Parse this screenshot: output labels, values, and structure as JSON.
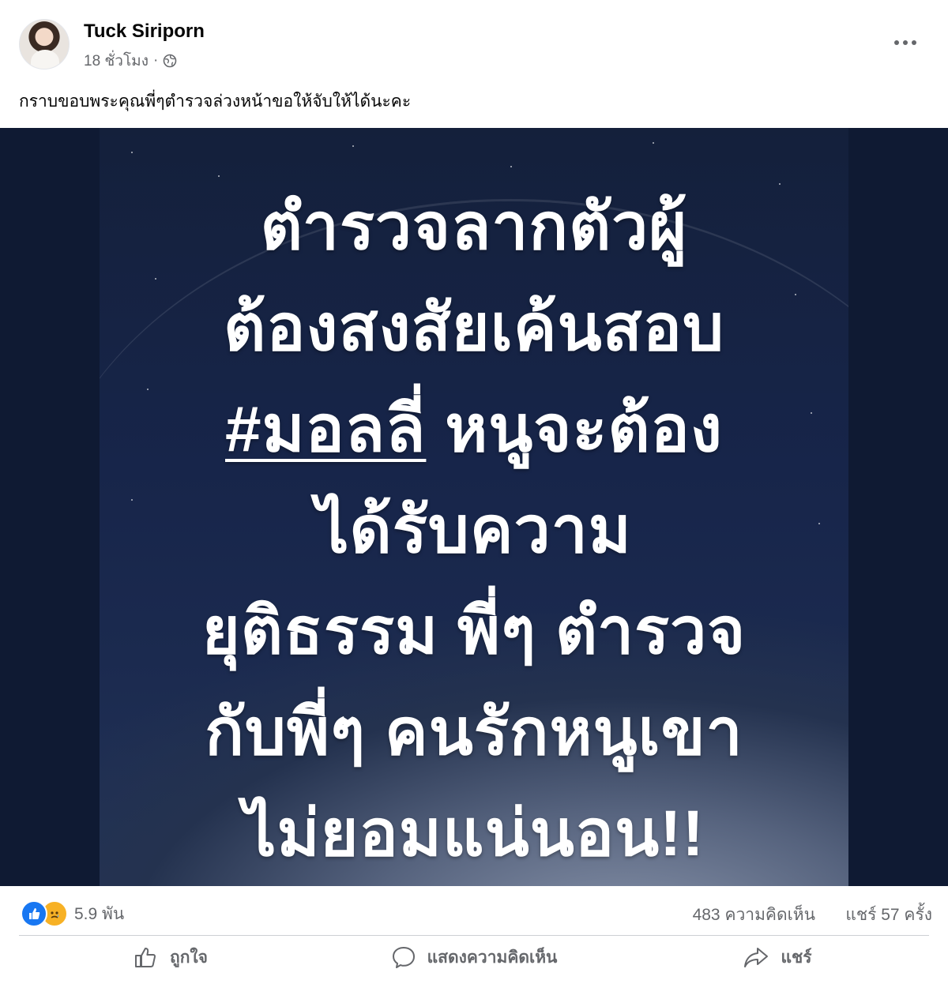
{
  "post": {
    "author": "Tuck Siriporn",
    "time": "18 ชั่วโมง",
    "separator": "·",
    "privacy_icon": "globe-icon",
    "caption": "กราบขอบพระคุณพี่ๆตำรวจล่วงหน้าขอให้จับให้ได้นะคะ"
  },
  "image": {
    "lines": [
      "ตำรวจลากตัวผู้",
      "ต้องสงสัยเค้นสอบ",
      "#มอลลี่",
      "หนูจะต้อง",
      "ได้รับความ",
      "ยุติธรรม พี่ๆ ตำรวจ",
      "กับพี่ๆ คนรักหนูเขา",
      "ไม่ยอมแน่นอน!!"
    ]
  },
  "stats": {
    "reactions": [
      "like-icon",
      "sad-icon"
    ],
    "reaction_count": "5.9 พัน",
    "comments": "483 ความคิดเห็น",
    "shares": "แชร์ 57 ครั้ง"
  },
  "actions": {
    "like": "ถูกใจ",
    "comment": "แสดงความคิดเห็น",
    "share": "แชร์"
  },
  "colors": {
    "accent": "#1877f2",
    "secondary_text": "#65676b",
    "image_background": "#17254a"
  }
}
